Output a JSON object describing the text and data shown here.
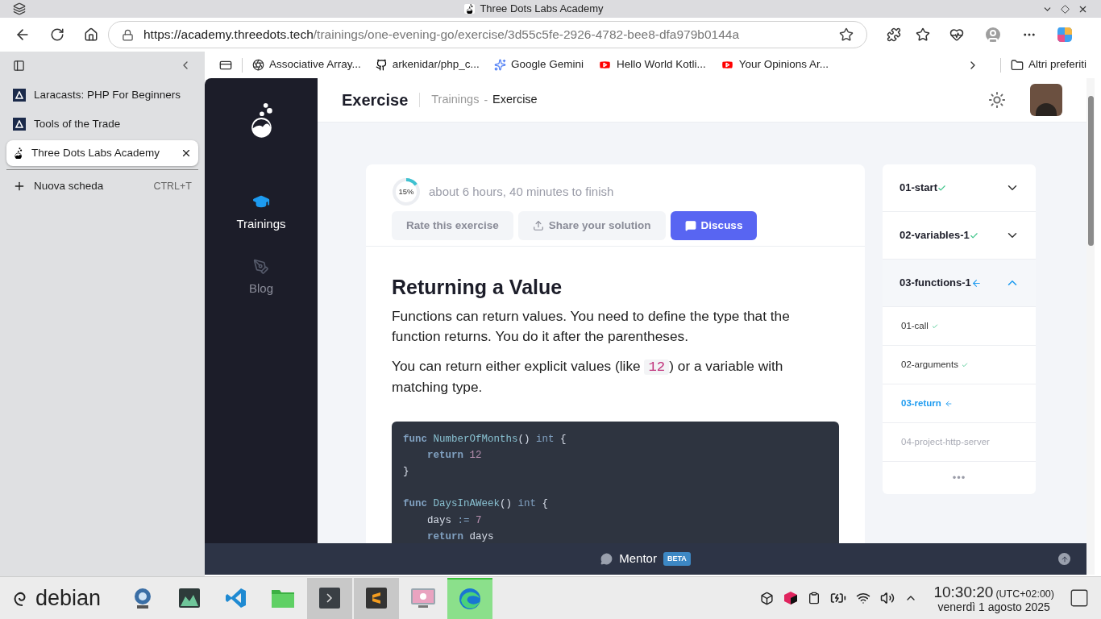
{
  "window": {
    "title": "Three Dots Labs Academy"
  },
  "toolbar": {
    "url_host": "https://academy.threedots.tech",
    "url_path": "/trainings/one-evening-go/exercise/3d55c5fe-2926-4782-bee8-dfa979b0144a"
  },
  "vertical_tabs": {
    "tabs": [
      {
        "title": "Laracasts: PHP For Beginners",
        "kind": "laracasts",
        "selected": false
      },
      {
        "title": "Tools of the Trade",
        "kind": "laracasts",
        "selected": false
      },
      {
        "title": "Three Dots Labs Academy",
        "kind": "flask",
        "selected": true
      }
    ],
    "new_tab": {
      "label": "Nuova scheda",
      "shortcut": "CTRL+T"
    }
  },
  "bookmarks": {
    "items": [
      {
        "label": "Associative Array...",
        "kind": "aperture"
      },
      {
        "label": "arkenidar/php_c...",
        "kind": "github"
      },
      {
        "label": "Google Gemini",
        "kind": "sparkle"
      },
      {
        "label": "Hello World Kotli...",
        "kind": "youtube"
      },
      {
        "label": "Your Opinions Ar...",
        "kind": "youtube"
      }
    ],
    "other": "Altri preferiti"
  },
  "site_nav": [
    {
      "label": "Trainings",
      "kind": "cap",
      "selected": true
    },
    {
      "label": "Blog",
      "kind": "pen",
      "selected": false
    }
  ],
  "header": {
    "title": "Exercise",
    "breadcrumbs": [
      "Trainings",
      "Exercise"
    ],
    "separator": "-"
  },
  "exercise": {
    "progress": {
      "label": "15%",
      "level": 0.15
    },
    "eta": "about 6 hours, 40 minutes to finish",
    "buttons": [
      {
        "label": "Rate this exercise",
        "kind": "plain"
      },
      {
        "label": "Share your solution",
        "kind": "share"
      },
      {
        "label": "Discuss",
        "kind": "primary"
      }
    ],
    "heading": "Returning a Value",
    "paragraphs": [
      [
        {
          "kind": "text",
          "text": "Functions can return values. You need to define the type that the function returns. You do it after the parentheses."
        }
      ],
      [
        {
          "kind": "text",
          "text": "You can return either explicit values (like "
        },
        {
          "kind": "code",
          "text": "12"
        },
        {
          "kind": "text",
          "text": ") or a variable with matching type."
        }
      ]
    ],
    "code_blocks": [
      [
        {
          "tokens": [
            {
              "kind": "keyword",
              "text": "func"
            },
            {
              "kind": "name",
              "text": " NumberOfMonths"
            },
            {
              "kind": "plain",
              "text": "() "
            },
            {
              "kind": "type",
              "text": "int"
            },
            {
              "kind": "plain",
              "text": " {"
            }
          ]
        },
        {
          "tokens": [
            {
              "kind": "keyword",
              "text": "    return"
            },
            {
              "kind": "number",
              "text": " 12"
            }
          ]
        },
        {
          "tokens": [
            {
              "kind": "plain",
              "text": "}"
            }
          ]
        }
      ],
      [
        {
          "tokens": [
            {
              "kind": "keyword",
              "text": "func"
            },
            {
              "kind": "name",
              "text": " DaysInAWeek"
            },
            {
              "kind": "plain",
              "text": "() "
            },
            {
              "kind": "type",
              "text": "int"
            },
            {
              "kind": "plain",
              "text": " {"
            }
          ]
        },
        {
          "tokens": [
            {
              "kind": "plain",
              "text": "    days "
            },
            {
              "kind": "op",
              "text": ":="
            },
            {
              "kind": "number",
              "text": " 7"
            }
          ]
        },
        {
          "tokens": [
            {
              "kind": "keyword",
              "text": "    return"
            },
            {
              "kind": "plain",
              "text": " days"
            }
          ]
        }
      ]
    ]
  },
  "outline": {
    "sections": [
      {
        "title": "01-start",
        "done": true,
        "current": false,
        "expanded": false
      },
      {
        "title": "02-variables-1",
        "done": true,
        "current": false,
        "expanded": false
      },
      {
        "title": "03-functions-1",
        "done": false,
        "current": true,
        "expanded": true,
        "children": [
          {
            "title": "01-call",
            "done": true,
            "current": false
          },
          {
            "title": "02-arguments",
            "done": true,
            "current": false
          },
          {
            "title": "03-return",
            "done": false,
            "current": true
          },
          {
            "title": "04-project-http-server",
            "done": false,
            "current": false
          }
        ]
      }
    ],
    "more": "•••"
  },
  "mentor": {
    "label": "Mentor",
    "badge": "BETA"
  },
  "taskbar": {
    "start": "debian",
    "apps": [
      {
        "kind": "webcam",
        "running": false,
        "active": false
      },
      {
        "kind": "monitor",
        "running": false,
        "active": false
      },
      {
        "kind": "vscode",
        "running": false,
        "active": false
      },
      {
        "kind": "files",
        "running": false,
        "active": false
      },
      {
        "kind": "terminal",
        "running": true,
        "active": false
      },
      {
        "kind": "sublime",
        "running": true,
        "active": false
      },
      {
        "kind": "screenshot",
        "running": false,
        "active": false
      },
      {
        "kind": "edge",
        "running": false,
        "active": true
      }
    ],
    "time": "10:30:20",
    "timezone": "(UTC+02:00)",
    "date": "venerdì 1 agosto 2025"
  }
}
